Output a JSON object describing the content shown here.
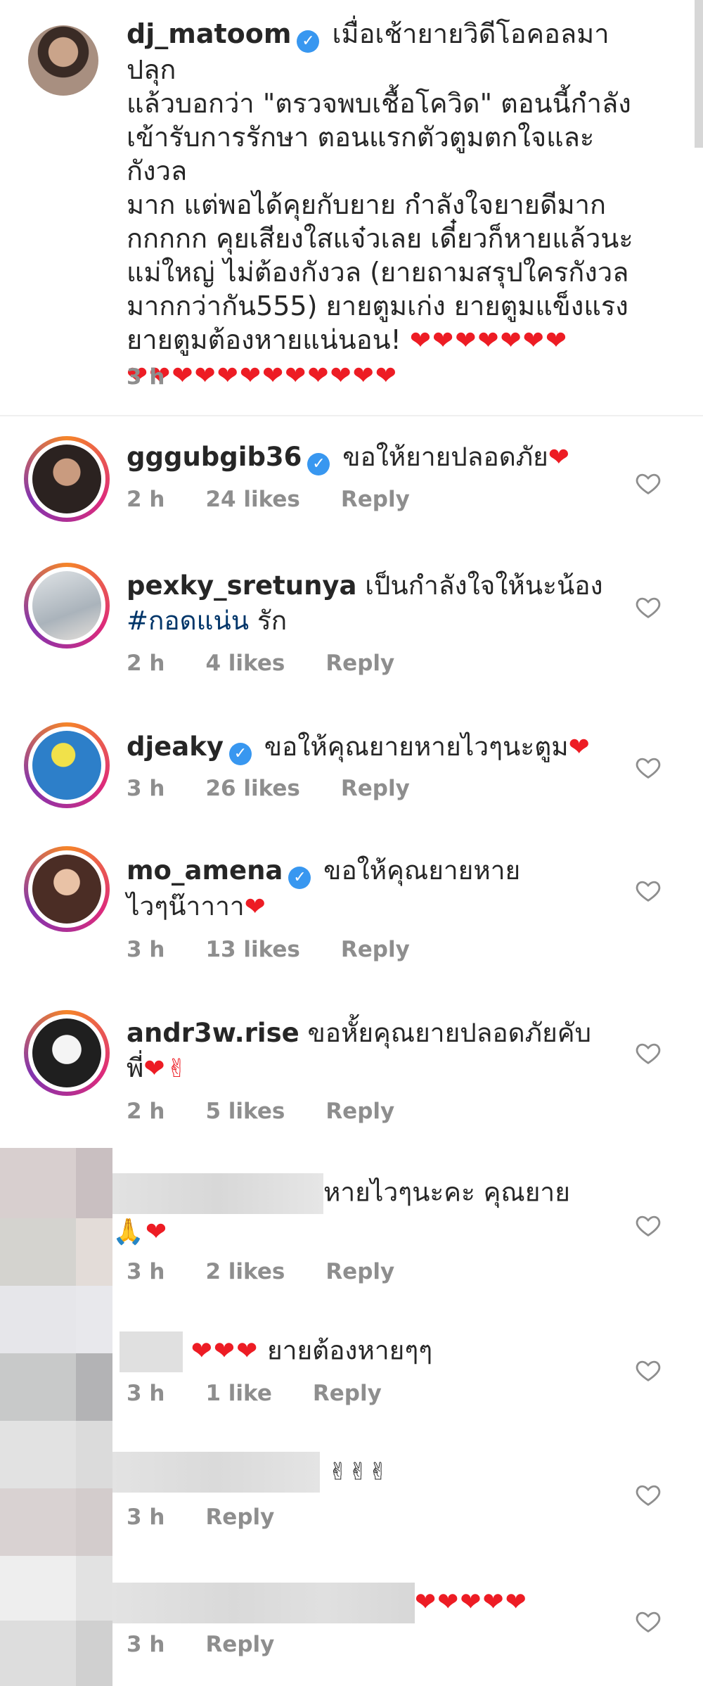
{
  "caption": {
    "username": "dj_matoom",
    "verified_mark": "✓",
    "body": " เมื่อเช้ายายวิดีโอคอลมาปลุก\nแล้วบอกว่า \"ตรวจพบเชื้อโควิด\" ตอนนี้กำลัง\nเข้ารับการรักษา ตอนแรกตัวตูมตกใจและกังวล\nมาก แต่พอได้คุยกับยาย กำลังใจยายดีมาก\nกกกกก คุยเสียงใสแจ๋วเลย เดี๋ยวก็หายแล้วนะ\nแม่ใหญ่ ไม่ต้องกังวล (ยายถามสรุปใครกังวล\nมากกว่ากัน555) ยายตูมเก่ง ยายตูมแข็งแรง\nยายตูมต้องหายแน่นอน! ",
    "hearts_line1": "❤❤❤❤❤❤❤",
    "hearts_line2": "❤❤❤❤❤❤❤❤❤❤❤❤",
    "time": "3 h"
  },
  "comments": [
    {
      "username": "gggubgib36",
      "verified": true,
      "text": "ขอให้ยายปลอดภัย",
      "hearts": "❤",
      "time": "2 h",
      "likes": "24 likes",
      "reply": "Reply"
    },
    {
      "username": "pexky_sretunya",
      "verified": false,
      "text": "เป็นกำลังใจให้นะน้อง",
      "hashtag": "#กอดแน่น",
      "text2": " รัก",
      "time": "2 h",
      "likes": "4 likes",
      "reply": "Reply"
    },
    {
      "username": "djeaky",
      "verified": true,
      "text": "ขอให้คุณยายหายไวๆนะตูม",
      "hearts": "❤",
      "time": "3 h",
      "likes": "26 likes",
      "reply": "Reply"
    },
    {
      "username": "mo_amena",
      "verified": true,
      "text": "ขอให้คุณยายหาย\nไวๆน๊าาาา",
      "hearts": "❤",
      "time": "3 h",
      "likes": "13 likes",
      "reply": "Reply"
    },
    {
      "username": "andr3w.rise",
      "verified": false,
      "text": "ขอหั้ยคุณยายปลอดภัยคับ\nพี่",
      "hearts": "❤✌",
      "time": "2 h",
      "likes": "5 likes",
      "reply": "Reply"
    },
    {
      "username": "",
      "text": "หายไวๆนะคะ คุณยาย\n",
      "hearts": "🙏❤",
      "time": "3 h",
      "likes": "2 likes",
      "reply": "Reply"
    },
    {
      "username": "",
      "text": " ยายต้องหายๆๆ",
      "hearts": "❤❤❤",
      "time": "3 h",
      "likes": "1 like",
      "reply": "Reply"
    },
    {
      "username": "",
      "text": "",
      "hearts": "✌✌✌",
      "time": "3 h",
      "reply": "Reply"
    },
    {
      "username": "",
      "text": "",
      "hearts": "❤❤❤❤❤",
      "time": "3 h",
      "reply": "Reply"
    }
  ],
  "colors": {
    "accent": "#3897f0",
    "heart": "#ed1c24",
    "meta": "#8e8e8e",
    "hashtag": "#003569"
  },
  "icons": {
    "like": "heart-outline-icon",
    "verified": "verified-badge-icon"
  }
}
